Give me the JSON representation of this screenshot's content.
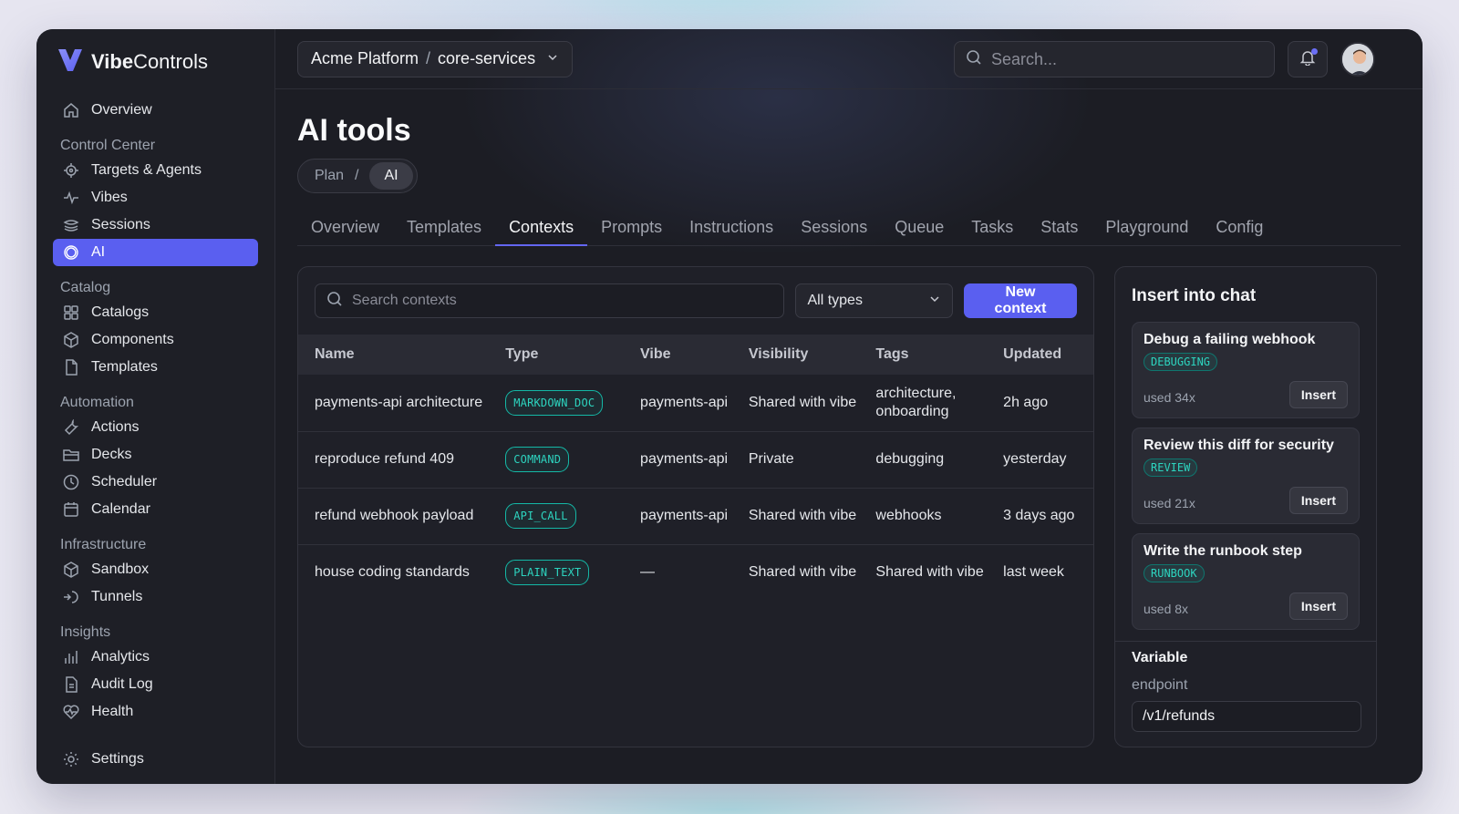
{
  "brand": {
    "name_bold": "Vibe",
    "name_rest": "Controls"
  },
  "colors": {
    "accent": "#5a5ff0",
    "badge": "#2dd4bf"
  },
  "sidebar": {
    "top": {
      "label": "Overview",
      "icon": "home-icon"
    },
    "sections": [
      {
        "title": "Control Center",
        "items": [
          {
            "label": "Targets & Agents",
            "icon": "target-icon"
          },
          {
            "label": "Vibes",
            "icon": "pulse-icon"
          },
          {
            "label": "Sessions",
            "icon": "layers-icon"
          },
          {
            "label": "AI",
            "icon": "ai-icon",
            "active": true
          }
        ]
      },
      {
        "title": "Catalog",
        "items": [
          {
            "label": "Catalogs",
            "icon": "grid-icon"
          },
          {
            "label": "Components",
            "icon": "box-icon"
          },
          {
            "label": "Templates",
            "icon": "file-icon"
          }
        ]
      },
      {
        "title": "Automation",
        "items": [
          {
            "label": "Actions",
            "icon": "wrench-icon"
          },
          {
            "label": "Decks",
            "icon": "folder-icon"
          },
          {
            "label": "Scheduler",
            "icon": "clock-icon"
          },
          {
            "label": "Calendar",
            "icon": "calendar-icon"
          }
        ]
      },
      {
        "title": "Infrastructure",
        "items": [
          {
            "label": "Sandbox",
            "icon": "cube-icon"
          },
          {
            "label": "Tunnels",
            "icon": "tunnel-icon"
          }
        ]
      },
      {
        "title": "Insights",
        "items": [
          {
            "label": "Analytics",
            "icon": "bar-chart-icon"
          },
          {
            "label": "Audit Log",
            "icon": "document-icon"
          },
          {
            "label": "Health",
            "icon": "heart-pulse-icon"
          }
        ]
      }
    ],
    "settings": {
      "label": "Settings",
      "icon": "gear-icon"
    }
  },
  "topbar": {
    "org": "Acme Platform",
    "project": "core-services",
    "search_placeholder": "Search..."
  },
  "page": {
    "title": "AI tools",
    "breadcrumb": [
      "Plan",
      "AI"
    ],
    "tabs": [
      "Overview",
      "Templates",
      "Contexts",
      "Prompts",
      "Instructions",
      "Sessions",
      "Queue",
      "Tasks",
      "Stats",
      "Playground",
      "Config"
    ],
    "active_tab": "Contexts"
  },
  "contexts": {
    "search_placeholder": "Search contexts",
    "type_filter": "All types",
    "new_button": "New context",
    "columns": [
      "Name",
      "Type",
      "Vibe",
      "Visibility",
      "Tags",
      "Updated"
    ],
    "rows": [
      {
        "name": "payments-api architecture",
        "type": "MARKDOWN_DOC",
        "vibe": "payments-api",
        "visibility": "Shared with vibe",
        "tags": "architecture, onboarding",
        "updated": "2h ago"
      },
      {
        "name": "reproduce refund 409",
        "type": "COMMAND",
        "vibe": "payments-api",
        "visibility": "Private",
        "tags": "debugging",
        "updated": "yesterday"
      },
      {
        "name": "refund webhook payload",
        "type": "API_CALL",
        "vibe": "payments-api",
        "visibility": "Shared with vibe",
        "tags": "webhooks",
        "updated": "3 days ago"
      },
      {
        "name": "house coding standards",
        "type": "PLAIN_TEXT",
        "vibe": "—",
        "visibility": "Shared with vibe",
        "tags": "Shared with vibe",
        "updated": "last week"
      }
    ]
  },
  "insert_panel": {
    "title": "Insert into chat",
    "cards": [
      {
        "title": "Debug a failing webhook",
        "badge": "DEBUGGING",
        "used": "used 34x",
        "button": "Insert"
      },
      {
        "title": "Review this diff for security",
        "badge": "REVIEW",
        "used": "used 21x",
        "button": "Insert"
      },
      {
        "title": "Write the runbook step",
        "badge": "RUNBOOK",
        "used": "used 8x",
        "button": "Insert"
      }
    ],
    "variable_label": "Variable",
    "variable_name": "endpoint",
    "variable_value": "/v1/refunds"
  }
}
